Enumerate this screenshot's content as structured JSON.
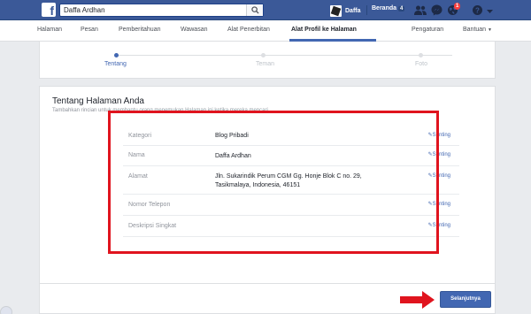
{
  "topbar": {
    "search_value": "Daffa Ardhan",
    "user_name": "Daffa",
    "home_label": "Beranda",
    "home_count": "4",
    "notif_count": "1"
  },
  "pagenav": {
    "items": [
      "Halaman",
      "Pesan",
      "Pemberitahuan",
      "Wawasan",
      "Alat Penerbitan",
      "Alat Profil ke Halaman",
      "Pengaturan",
      "Bantuan"
    ]
  },
  "steps": [
    "Tentang",
    "Teman",
    "Foto"
  ],
  "card": {
    "title": "Tentang Halaman Anda",
    "subtitle": "Tambahkan rincian untuk membantu orang menemukan Halaman ini ketika mereka mencari.",
    "next_label": "Selanjutnya"
  },
  "info_rows": [
    {
      "label": "Kategori",
      "value": "Blog Pribadi",
      "edit": "Sunting"
    },
    {
      "label": "Nama",
      "value": "Daffa Ardhan",
      "edit": "Sunting"
    },
    {
      "label": "Alamat",
      "value": "Jln. Sukarindik Perum CGM Gg. Honje Blok C no. 29, Tasikmalaya, Indonesia, 46151",
      "edit": "Sunting"
    },
    {
      "label": "Nomor Telepon",
      "value": "",
      "edit": "Sunting"
    },
    {
      "label": "Deskripsi Singkat",
      "value": "",
      "edit": "Sunting"
    }
  ],
  "colors": {
    "brand": "#3b5998",
    "accent": "#4267b2",
    "annotation": "#e0141e"
  },
  "icons": [
    "facebook-logo-icon",
    "search-icon",
    "friends-icon",
    "messenger-icon",
    "globe-icon",
    "help-icon",
    "dropdown-icon",
    "pencil-icon",
    "arrow-icon"
  ]
}
